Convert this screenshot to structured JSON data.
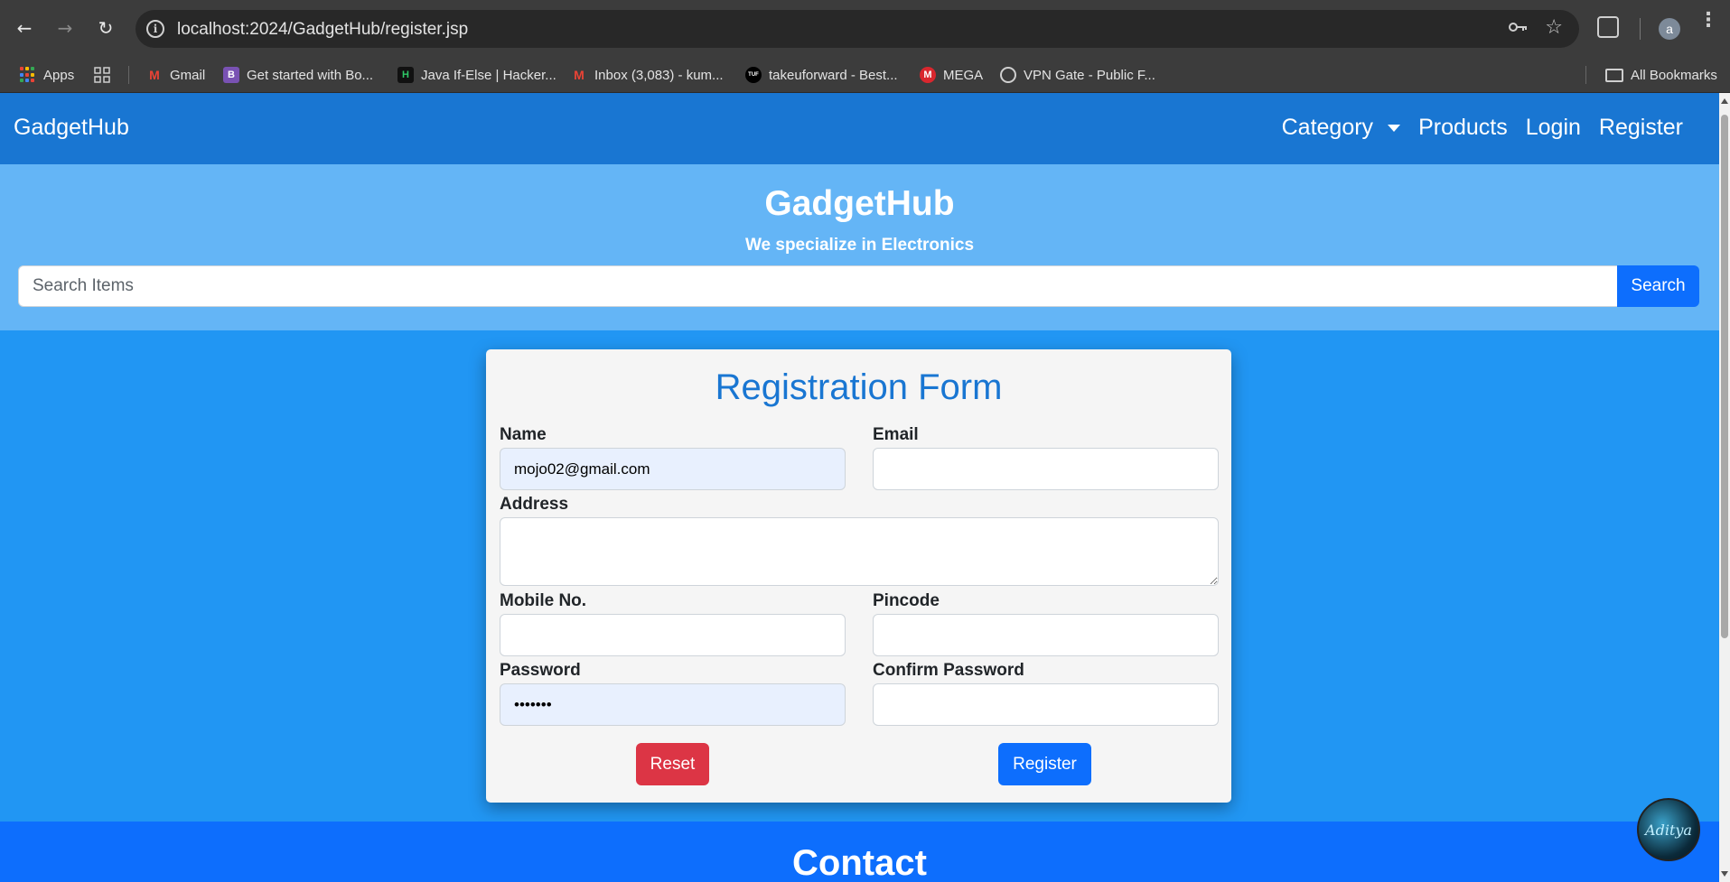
{
  "browser": {
    "url": "localhost:2024/GadgetHub/register.jsp",
    "profile_initial": "a",
    "bookmarks": [
      {
        "label": "Apps",
        "icon": "apps-grid-icon"
      },
      {
        "label": "Gmail",
        "icon": "gmail-icon"
      },
      {
        "label": "Get started with Bo...",
        "icon": "bootstrap-icon",
        "icon_text": "B"
      },
      {
        "label": "Java If-Else | Hacker...",
        "icon": "hackerrank-icon",
        "icon_text": "H"
      },
      {
        "label": "Inbox (3,083) - kum...",
        "icon": "gmail-icon"
      },
      {
        "label": "takeuforward - Best...",
        "icon": "tuf-icon",
        "icon_text": "TUF"
      },
      {
        "label": "MEGA",
        "icon": "mega-icon",
        "icon_text": "M"
      },
      {
        "label": "VPN Gate - Public F...",
        "icon": "globe-icon"
      }
    ],
    "all_bookmarks_label": "All Bookmarks"
  },
  "navbar": {
    "brand": "GadgetHub",
    "links": {
      "category": "Category",
      "products": "Products",
      "login": "Login",
      "register": "Register"
    }
  },
  "hero": {
    "title": "GadgetHub",
    "subtitle": "We specialize in Electronics",
    "search_placeholder": "Search Items",
    "search_button": "Search"
  },
  "form": {
    "title": "Registration Form",
    "name_label": "Name",
    "name_value": "mojo02@gmail.com",
    "email_label": "Email",
    "email_value": "",
    "address_label": "Address",
    "address_value": "",
    "mobile_label": "Mobile No.",
    "mobile_value": "",
    "pincode_label": "Pincode",
    "pincode_value": "",
    "password_label": "Password",
    "password_value": "•••••••",
    "confirm_password_label": "Confirm Password",
    "confirm_password_value": "",
    "reset_button": "Reset",
    "register_button": "Register"
  },
  "footer": {
    "title": "Contact"
  },
  "floating_avatar_text": "Aditya",
  "colors": {
    "navbar": "#1976d2",
    "hero": "#64b5f6",
    "main_bg": "#2196f3",
    "primary": "#0d6efd",
    "danger": "#dc3545",
    "form_title": "#1976d2"
  }
}
